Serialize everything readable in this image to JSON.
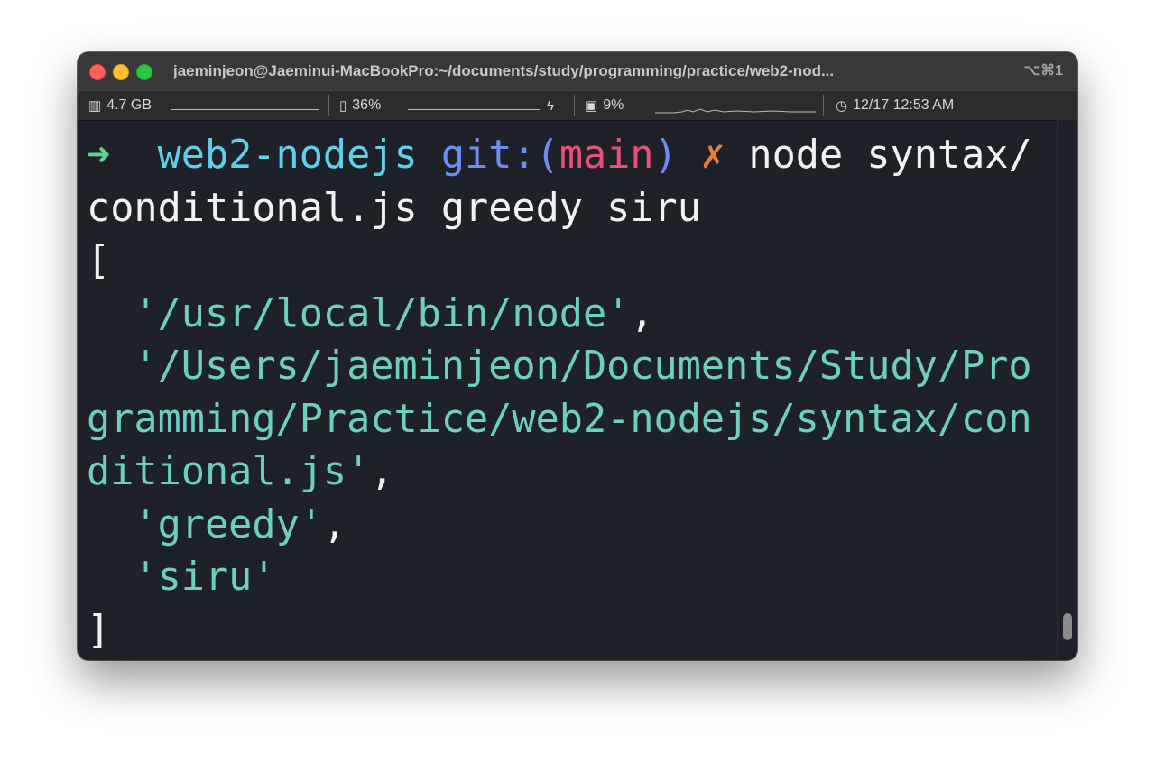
{
  "window": {
    "title": "jaeminjeon@Jaeminui-MacBookPro:~/documents/study/programming/practice/web2-nod...",
    "shortcut": "⌥⌘1"
  },
  "statusbar": {
    "memory": "4.7 GB",
    "battery": "36%",
    "cpu": "9%",
    "datetime": "12/17 12:53 AM"
  },
  "terminal": {
    "prompt_arrow": "➜",
    "prompt_dir": "web2-nodejs",
    "git_prefix": "git:(",
    "git_branch": "main",
    "git_suffix": ")",
    "dirty_mark": "✗",
    "command_part1": "node syntax/",
    "command_part2": "conditional.js greedy siru",
    "output": {
      "open_bracket": "[",
      "item1": "'/usr/local/bin/node'",
      "item2_line1": "'/Users/jaeminjeon/Documents/Study/Pro",
      "item2_line2": "gramming/Practice/web2-nodejs/syntax/con",
      "item2_line3": "ditional.js'",
      "item3": "'greedy'",
      "item4": "'siru'",
      "comma": ",",
      "close_bracket": "]"
    }
  },
  "colors": {
    "background": "#1e2228",
    "prompt_arrow": "#5ed18a",
    "directory": "#5fd0ea",
    "git": "#6d8cf5",
    "branch": "#e8507a",
    "dirty": "#e8803a",
    "string": "#6dcfc2"
  }
}
